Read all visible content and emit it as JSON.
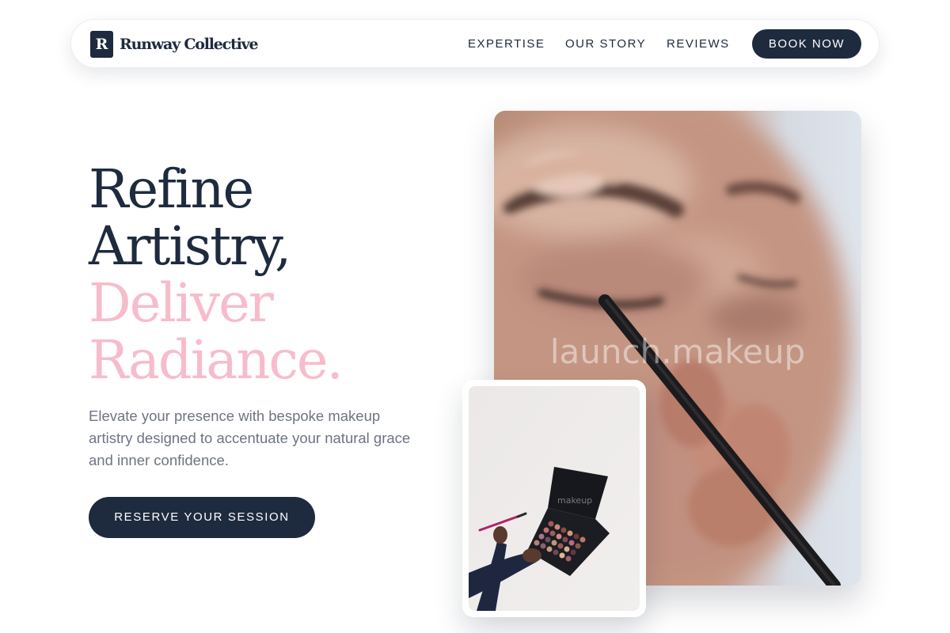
{
  "brand": {
    "logo_letter": "R",
    "name": "Runway Collective"
  },
  "nav": {
    "links": [
      "EXPERTISE",
      "OUR STORY",
      "REVIEWS"
    ],
    "cta_label": "BOOK NOW"
  },
  "hero": {
    "headline_line1": "Refine",
    "headline_line2": "Artistry,",
    "headline_line3": "Deliver",
    "headline_line4": "Radiance.",
    "description": "Elevate your presence with bespoke makeup artistry designed to accentuate your natural grace and inner confidence.",
    "cta_label": "RESERVE YOUR SESSION"
  },
  "images": {
    "main_watermark": "launch.makeup",
    "card_watermark": "makeup"
  },
  "colors": {
    "navy": "#1e2a3e",
    "pink": "#f7bccb",
    "muted_text": "#6e7481"
  }
}
